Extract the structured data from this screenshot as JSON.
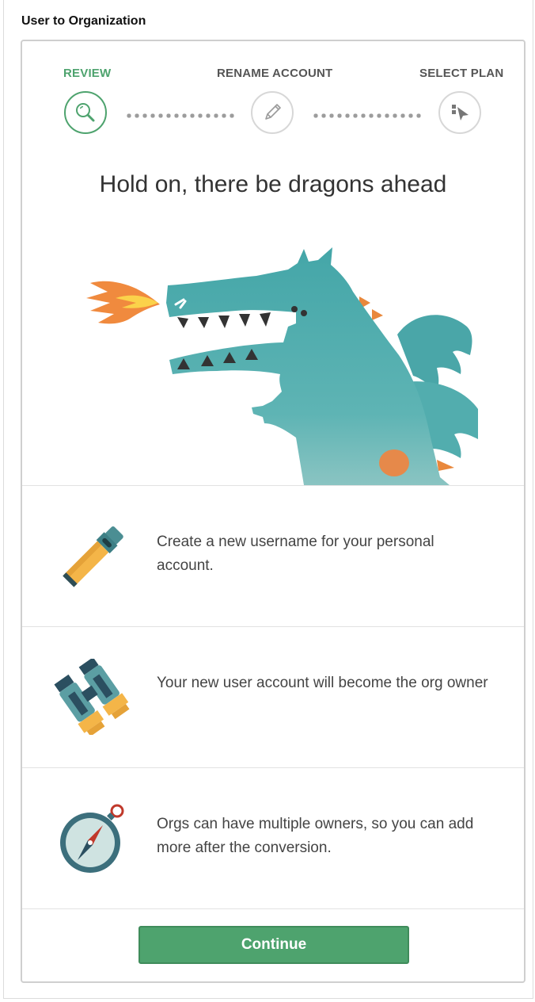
{
  "page": {
    "heading": "User to Organization"
  },
  "stepper": {
    "steps": [
      {
        "label": "REVIEW",
        "icon": "magnifier-icon",
        "active": true
      },
      {
        "label": "RENAME ACCOUNT",
        "icon": "pencil-icon",
        "active": false
      },
      {
        "label": "SELECT PLAN",
        "icon": "cursor-icon",
        "active": false
      }
    ]
  },
  "hero": {
    "title": "Hold on, there be dragons ahead",
    "illustration": "dragon-illustration"
  },
  "info": [
    {
      "icon": "flashlight-icon",
      "text": "Create a new username for your personal account."
    },
    {
      "icon": "binoculars-icon",
      "text": "Your new user account will become the org owner"
    },
    {
      "icon": "compass-icon",
      "text": "Orgs can have multiple owners, so you can add more after the conversion."
    }
  ],
  "actions": {
    "continue_label": "Continue"
  },
  "colors": {
    "accent": "#4ea36e",
    "dragon": "#4ba7a8",
    "fire": "#f0883e"
  }
}
